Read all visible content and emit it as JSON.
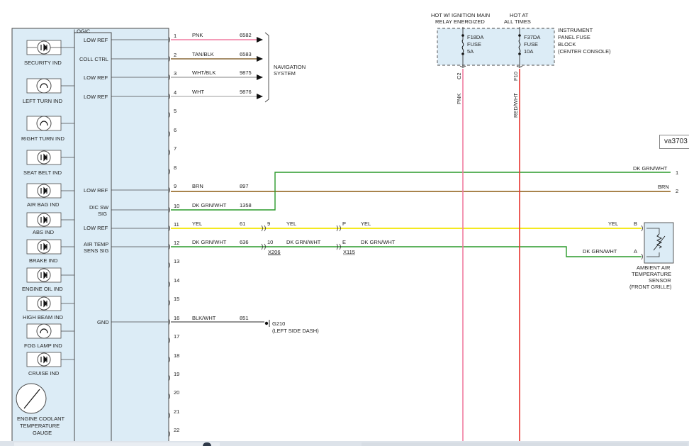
{
  "module": {
    "title": "LOGIC",
    "pin_labels": [
      "LOW REF",
      "COLL CTRL",
      "LOW REF",
      "LOW REF",
      "LOW REF",
      "DIC SW SIG",
      "LOW REF",
      "AIR TEMP SENS SIG",
      "GND"
    ],
    "indicators": [
      "SECURITY IND",
      "LEFT TURN IND",
      "RIGHT TURN IND",
      "SEAT BELT IND",
      "AIR BAG IND",
      "ABS IND",
      "BRAKE IND",
      "ENGINE OIL IND",
      "HIGH BEAM IND",
      "FOG LAMP IND",
      "CRUISE IND"
    ],
    "gauge_label": "ENGINE COOLANT TEMPERATURE GAUGE"
  },
  "pins": [
    "1",
    "2",
    "3",
    "4",
    "5",
    "6",
    "7",
    "8",
    "9",
    "10",
    "11",
    "12",
    "13",
    "14",
    "15",
    "16",
    "17",
    "18",
    "19",
    "20",
    "21",
    "22"
  ],
  "wires": {
    "w1": {
      "color_name": "PNK",
      "circuit": "6582",
      "color": "#f07ca0"
    },
    "w2": {
      "color_name": "TAN/BLK",
      "circuit": "6583",
      "color": "#8a6a3a"
    },
    "w3": {
      "color_name": "WHT/BLK",
      "circuit": "9875",
      "color": "#9a9a9a"
    },
    "w4": {
      "color_name": "WHT",
      "circuit": "9876",
      "color": "#b0b0b0"
    },
    "w9": {
      "color_name": "BRN",
      "circuit": "897",
      "color": "#8b5a10"
    },
    "w10": {
      "color_name": "DK GRN/WHT",
      "circuit": "1358",
      "color": "#2a9a2a"
    },
    "w11": {
      "color_name": "YEL",
      "circuit": "61",
      "color": "#f2e600"
    },
    "w12": {
      "color_name": "DK GRN/WHT",
      "circuit": "636",
      "color": "#2a9a2a"
    },
    "w16": {
      "color_name": "BLK/WHT",
      "circuit": "851",
      "color": "#555555"
    }
  },
  "navigation": {
    "label": "NAVIGATION SYSTEM"
  },
  "ground": {
    "id": "G210",
    "location": "(LEFT SIDE DASH)"
  },
  "connectors": {
    "x206": {
      "id": "X206",
      "pin_a": "9",
      "pin_b": "10"
    },
    "x115": {
      "id": "X115",
      "pin_a": "P",
      "pin_b": "E"
    }
  },
  "segments": {
    "yel": "YEL",
    "dkgrn": "DK GRN/WHT"
  },
  "right_side": {
    "wire1_label": "DK GRN/WHT",
    "wire1_pin": "1",
    "wire2_label": "BRN",
    "wire2_pin": "2",
    "sensor_pin_b_label": "YEL",
    "sensor_pin_a_label": "DK GRN/WHT",
    "pin_b": "B",
    "pin_a": "A",
    "sensor_label": "AMBIENT AIR TEMPERATURE SENSOR (FRONT GRILLE)"
  },
  "fuse_block": {
    "hot_ign": "HOT W/ IGNITION MAIN RELAY ENERGIZED",
    "hot_all": "HOT AT ALL TIMES",
    "label": "INSTRUMENT PANEL FUSE BLOCK (CENTER CONSOLE)",
    "f1_name": "F18DA",
    "f1_type": "FUSE",
    "f1_rating": "5A",
    "f2_name": "F37DA",
    "f2_type": "FUSE",
    "f2_rating": "10A",
    "c1_pin": "C2",
    "c1_wire": "PNK",
    "c2_pin": "F10",
    "c2_wire": "RED/WHT"
  },
  "ref_tag": "va3703",
  "colors": {
    "panel_fill": "#dcecf6",
    "panel_stroke": "#4a4a4a",
    "pink": "#f07ca0",
    "red": "#e8342f",
    "green": "#2a9a2a",
    "yellow": "#f2e600",
    "brown": "#8b5a10"
  }
}
